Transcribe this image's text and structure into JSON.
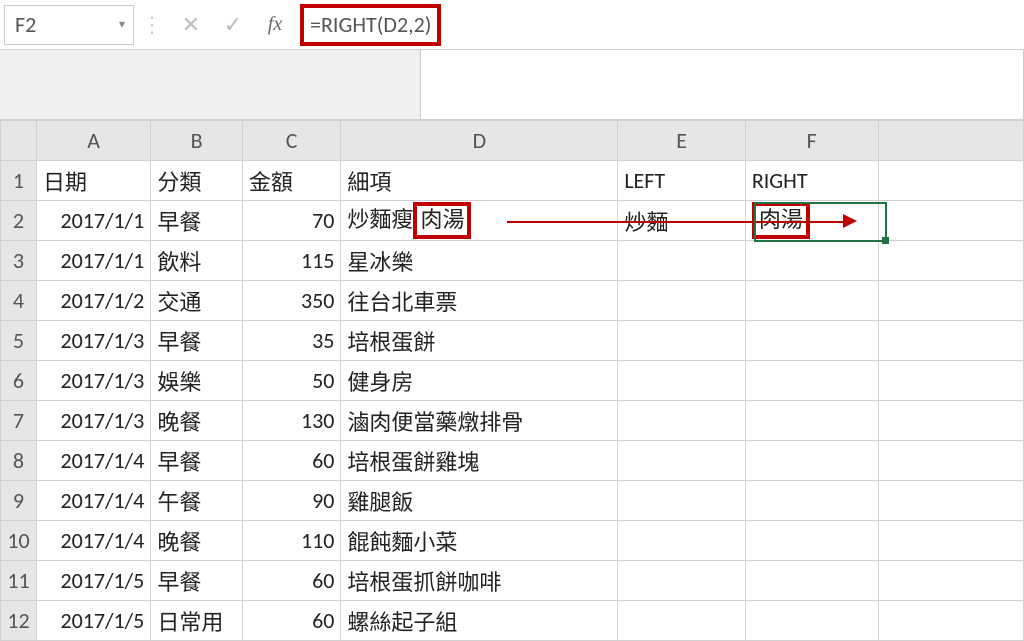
{
  "formula_bar": {
    "name_box": "F2",
    "fx_label": "fx",
    "formula": "=RIGHT(D2,2)"
  },
  "columns": {
    "A": "A",
    "B": "B",
    "C": "C",
    "D": "D",
    "E": "E",
    "F": "F",
    "G": ""
  },
  "headers": {
    "r": "1",
    "A": "日期",
    "B": "分類",
    "C": "金額",
    "D": "細項",
    "E": "LEFT",
    "F": "RIGHT"
  },
  "rows": [
    {
      "r": "2",
      "A": "2017/1/1",
      "B": "早餐",
      "C": "70",
      "D_pre": "炒麵瘦",
      "D_hl": "肉湯",
      "E": "炒麵",
      "F": "肉湯"
    },
    {
      "r": "3",
      "A": "2017/1/1",
      "B": "飲料",
      "C": "115",
      "D": "星冰樂"
    },
    {
      "r": "4",
      "A": "2017/1/2",
      "B": "交通",
      "C": "350",
      "D": "往台北車票"
    },
    {
      "r": "5",
      "A": "2017/1/3",
      "B": "早餐",
      "C": "35",
      "D": "培根蛋餅"
    },
    {
      "r": "6",
      "A": "2017/1/3",
      "B": "娛樂",
      "C": "50",
      "D": "健身房"
    },
    {
      "r": "7",
      "A": "2017/1/3",
      "B": "晚餐",
      "C": "130",
      "D": "滷肉便當藥燉排骨"
    },
    {
      "r": "8",
      "A": "2017/1/4",
      "B": "早餐",
      "C": "60",
      "D": "培根蛋餅雞塊"
    },
    {
      "r": "9",
      "A": "2017/1/4",
      "B": "午餐",
      "C": "90",
      "D": "雞腿飯"
    },
    {
      "r": "10",
      "A": "2017/1/4",
      "B": "晚餐",
      "C": "110",
      "D": "餛飩麵小菜"
    },
    {
      "r": "11",
      "A": "2017/1/5",
      "B": "早餐",
      "C": "60",
      "D": "培根蛋抓餅咖啡"
    },
    {
      "r": "12",
      "A": "2017/1/5",
      "B": "日常用",
      "C": "60",
      "D": "螺絲起子組"
    }
  ],
  "icons": {
    "dropdown": "▾",
    "sep": "⋮",
    "cancel": "✕",
    "confirm": "✓"
  }
}
